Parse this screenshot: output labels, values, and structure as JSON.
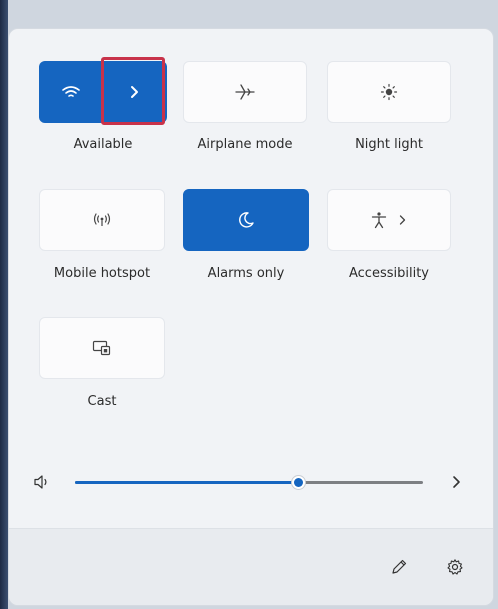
{
  "quick_settings": {
    "tiles": [
      {
        "id": "wifi",
        "label": "Available",
        "state": "on",
        "icon": "wifi-icon",
        "expand_icon": "chevron-right-icon"
      },
      {
        "id": "airplane",
        "label": "Airplane mode",
        "state": "off",
        "icon": "airplane-icon"
      },
      {
        "id": "night-light",
        "label": "Night light",
        "state": "off",
        "icon": "brightness-icon"
      },
      {
        "id": "hotspot",
        "label": "Mobile hotspot",
        "state": "off",
        "icon": "hotspot-icon"
      },
      {
        "id": "focus",
        "label": "Alarms only",
        "state": "on",
        "icon": "moon-icon"
      },
      {
        "id": "accessibility",
        "label": "Accessibility",
        "state": "off",
        "icon": "accessibility-icon",
        "expand_icon": "chevron-right-icon"
      },
      {
        "id": "cast",
        "label": "Cast",
        "state": "off",
        "icon": "cast-icon"
      }
    ]
  },
  "volume": {
    "icon": "speaker-icon",
    "level_fraction": 0.64,
    "expand_icon": "chevron-right-icon"
  },
  "footer": {
    "edit_icon": "pencil-icon",
    "settings_icon": "gear-icon"
  },
  "colors": {
    "accent": "#1565c0",
    "highlight_border": "#c8324a",
    "panel_background": "#f1f3f6"
  }
}
